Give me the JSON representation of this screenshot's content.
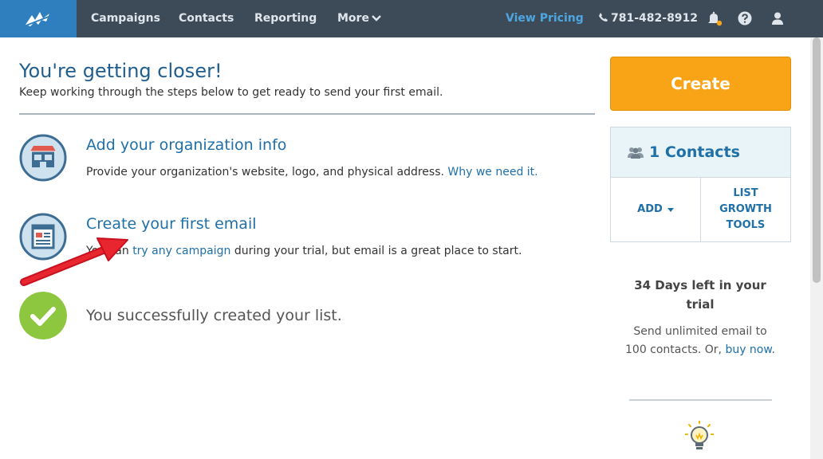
{
  "nav": {
    "campaigns": "Campaigns",
    "contacts": "Contacts",
    "reporting": "Reporting",
    "more": "More",
    "pricing": "View Pricing",
    "phone": "781-482-8912"
  },
  "main": {
    "heading": "You're getting closer!",
    "subheading": "Keep working through the steps below to get ready to send your first email.",
    "steps": [
      {
        "title": "Add your organization info",
        "desc_before": "Provide your organization's website, logo, and physical address. ",
        "desc_link": "Why we need it."
      },
      {
        "title": "Create your first email",
        "desc_before": "You can ",
        "desc_link": "try any campaign",
        "desc_after": " during your trial, but email is a great place to start."
      },
      {
        "title": "You successfully created your list."
      }
    ]
  },
  "sidebar": {
    "create_label": "Create",
    "contacts_count": "1 Contacts",
    "add_label": "ADD",
    "list_growth_line1": "LIST",
    "list_growth_line2": "GROWTH",
    "list_growth_line3": "TOOLS",
    "trial_title_line1": "34 Days left in your",
    "trial_title_line2": "trial",
    "trial_desc_before": "Send unlimited email to 100 contacts. Or, ",
    "trial_desc_link": "buy now",
    "trial_desc_after": "."
  },
  "colors": {
    "topbar": "#3d4b59",
    "logo_bg": "#2f7fbf",
    "accent": "#f8a416",
    "link": "#1f6fa8",
    "success": "#8dc63f"
  }
}
